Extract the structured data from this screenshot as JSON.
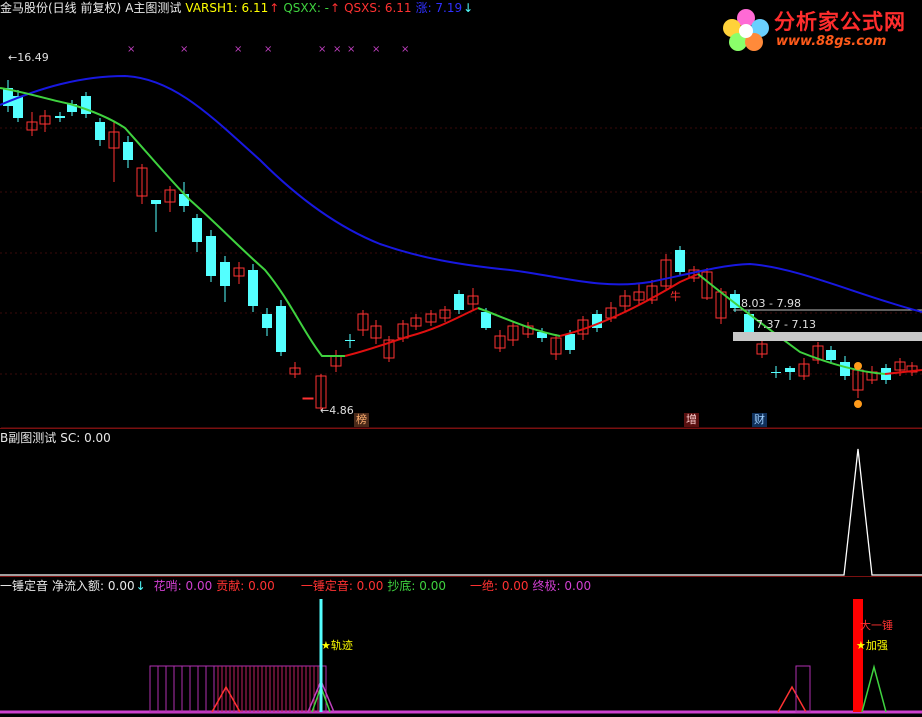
{
  "main": {
    "stock": "金马股份(日线 前复权)",
    "indicator": "A主图测试",
    "varsh1": "VARSH1: 6.11",
    "varsh1_arrow": "↑",
    "qsxx": "QSXX: -",
    "qsxs": "QSXS: 6.11",
    "qsxs_arrow": "↑",
    "zhang": "涨: 7.19",
    "zhang_arrow": "↓",
    "high_label": "16.49",
    "low_label": "4.86",
    "label_niu": "牛",
    "range1": "8.03 - 7.98",
    "range2": "7.37 - 7.13",
    "tag_bang": "榜",
    "tag_zeng": "增",
    "tag_cai": "财",
    "colors": {
      "up": "#ff3232",
      "down": "#54ffff",
      "ma_long": "#1818e0",
      "ma_short_up": "#e01010",
      "ma_short_down": "#3fd23f"
    }
  },
  "sub": {
    "title": "B副图测试",
    "sc": "SC: 0.00"
  },
  "ind": {
    "title": "一锤定音",
    "net": "净流入额: 0.00",
    "net_arrow": "↓",
    "hua": "花哨: 0.00",
    "gong": "贡献: 0.00",
    "yichui": "一锤定音: 0.00",
    "chaodi": "抄底: 0.00",
    "yijue": "一绝: 0.00",
    "zhongji": "终极: 0.00",
    "guiji": "★轨迹",
    "jiaqiang": "★加强",
    "dayichui": "大一锤"
  },
  "logo": {
    "title": "分析家公式网",
    "url": "www.88gs.com"
  },
  "icons": {
    "logo": "flower-logo-icon"
  }
}
